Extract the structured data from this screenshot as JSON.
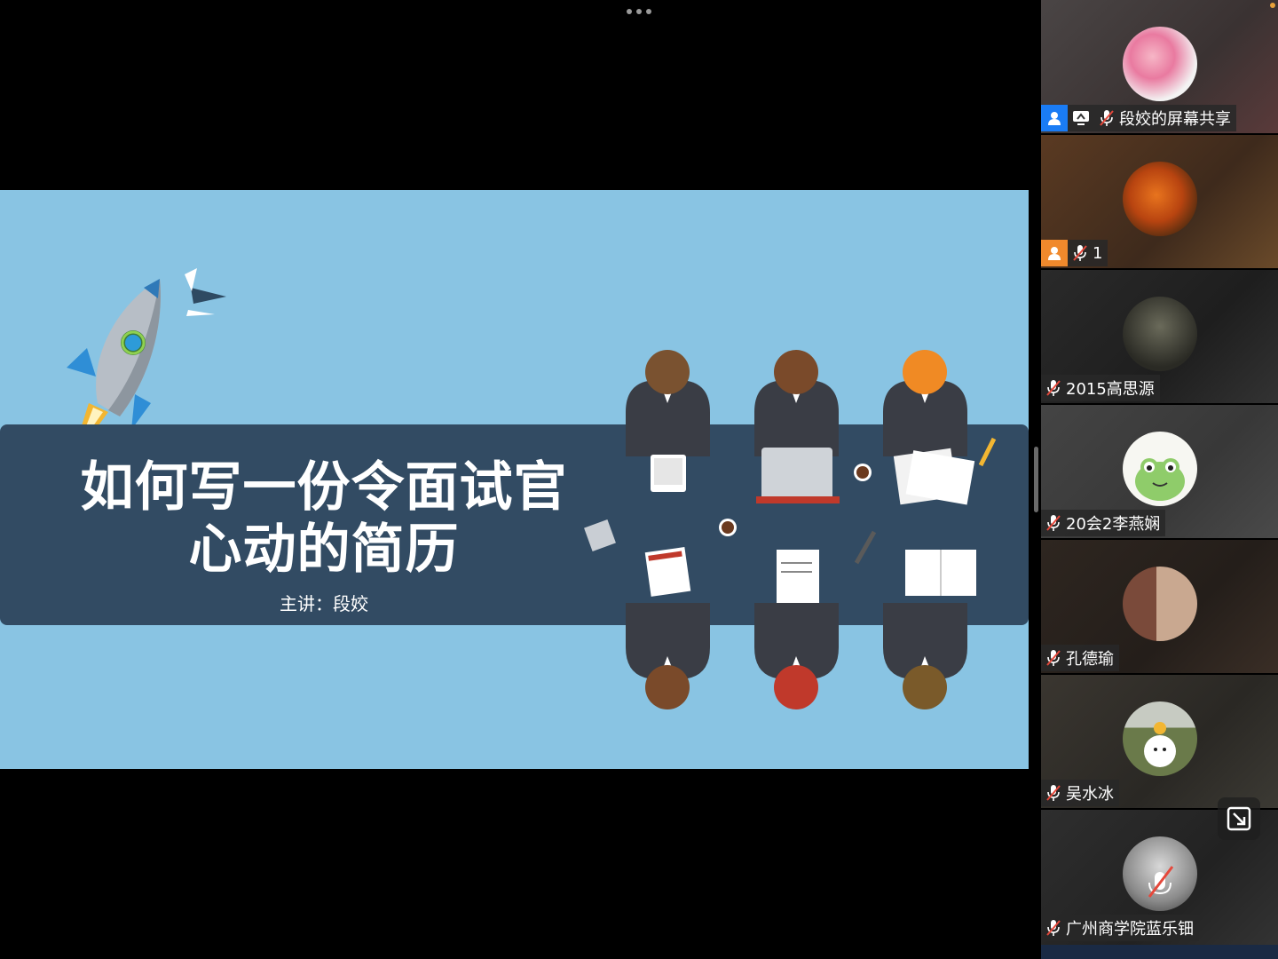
{
  "slide": {
    "title_line1": "如何写一份令面试官",
    "title_line2": "心动的简历",
    "presenter": "主讲：段姣"
  },
  "participants": [
    {
      "name": "段姣的屏幕共享",
      "badge": "person-icon",
      "badge_color": "#1a7cf5",
      "sharing": true,
      "muted": true,
      "avatar": "flowers",
      "bg": "#3b3535"
    },
    {
      "name": "1",
      "badge": "person-icon",
      "badge_color": "#f0892c",
      "sharing": false,
      "muted": true,
      "avatar": "orange-flower",
      "bg": "#4a2e20"
    },
    {
      "name": "2015高思源",
      "muted": true,
      "avatar": "dark-photo",
      "bg": "#262626"
    },
    {
      "name": "20会2李燕娴",
      "muted": true,
      "avatar": "frog-cartoon",
      "bg": "#3e3e3e"
    },
    {
      "name": "孔德瑜",
      "muted": true,
      "avatar": "brick-building",
      "bg": "#2c2622"
    },
    {
      "name": "吴水冰",
      "muted": true,
      "avatar": "dog-sunflower",
      "bg": "#322f2a"
    },
    {
      "name": "广州商学院蓝乐钿",
      "muted": true,
      "avatar": "woman-photo",
      "bg": "#2b2b2b"
    }
  ],
  "colors": {
    "slide_bg": "#89c4e3",
    "title_band": "#324b63",
    "mute_red": "#e5483b"
  }
}
